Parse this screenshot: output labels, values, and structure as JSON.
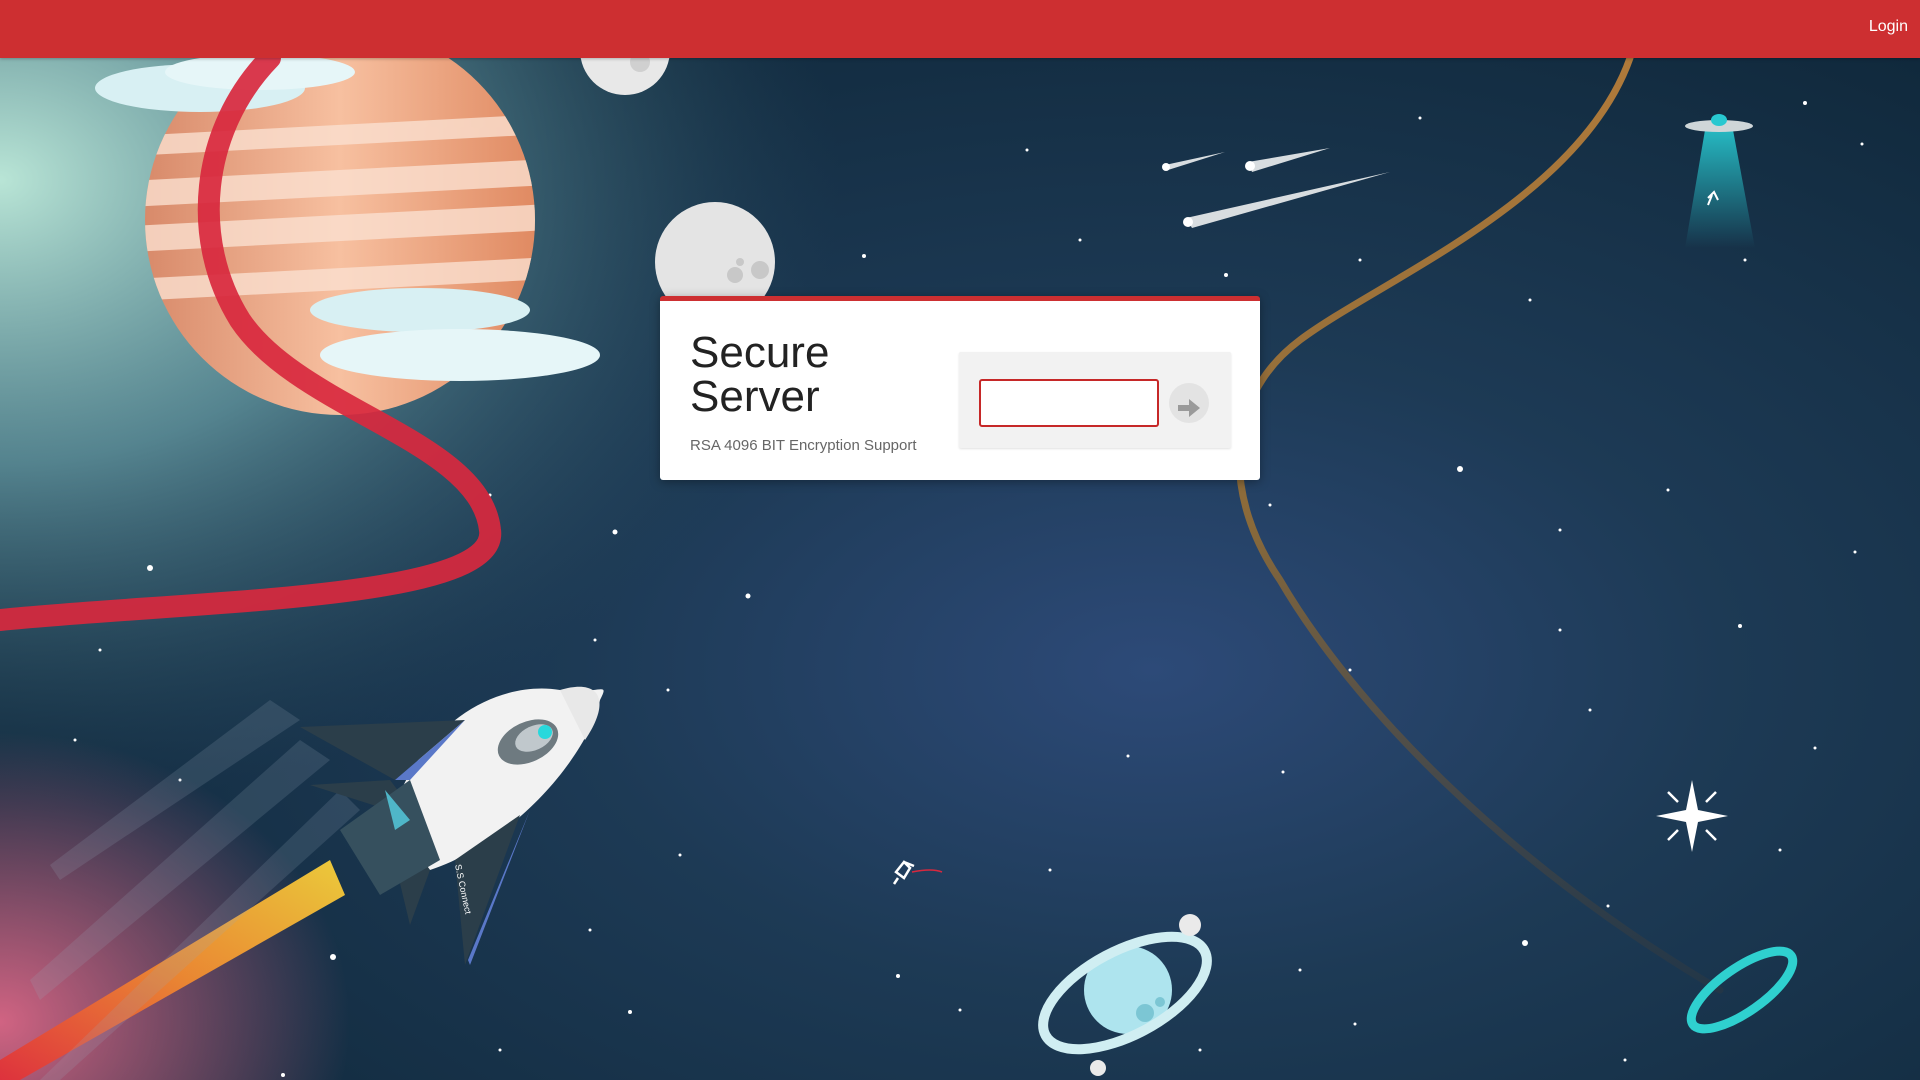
{
  "topbar": {
    "background": "#cd2f31",
    "login_label": "Login"
  },
  "card": {
    "title": "Secure Server",
    "subtitle": "RSA 4096 BIT Encryption Support",
    "accent": "#cd2f31"
  },
  "form": {
    "password_value": "",
    "submit_icon": "arrow-right-icon"
  },
  "scene": {
    "rocket_decal": "S.S Connect"
  }
}
